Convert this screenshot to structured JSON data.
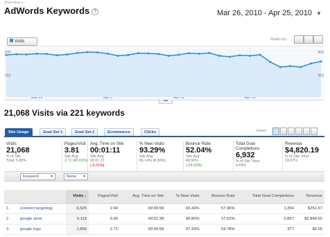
{
  "breadcrumb": "Overview »",
  "page_title": "AdWords Keywords",
  "help_glyph": "?",
  "date_range": "Mar 26, 2010 - Apr 25, 2010",
  "graph": {
    "metric_label": "Visits",
    "graph_by_label": "Graph by:",
    "y_label_top": "900",
    "y_label_mid": "450",
    "x_ticks": [
      "Mar 29",
      "Apr 5",
      "Apr 12",
      "Apr 19"
    ],
    "accent": "#2f8fdf"
  },
  "chart_data": {
    "type": "line",
    "series": [
      {
        "name": "Visits",
        "values": [
          815,
          830,
          825,
          840,
          835,
          810,
          825,
          855,
          870,
          865,
          840,
          800,
          815,
          850,
          845,
          835,
          800,
          820,
          850,
          840,
          855,
          800,
          780,
          810,
          800,
          820,
          680,
          580,
          600,
          580,
          650,
          690
        ]
      }
    ],
    "ylim": [
      0,
      900
    ],
    "y_ticks": [
      "450",
      "900"
    ],
    "x_tick_labels": [
      "Mar 29",
      "Apr 5",
      "Apr 12",
      "Apr 19"
    ],
    "grid": true
  },
  "summary": "21,068 Visits via 221 keywords",
  "tabs": [
    "Site Usage",
    "Goal Set 1",
    "Goal Set 2",
    "Ecommerce",
    "Clicks"
  ],
  "views_label": "Views:",
  "metrics": [
    {
      "label": "Visits",
      "value": "21,068",
      "sub1": "% of Site",
      "sub2": "Total: 5.88%",
      "sub3": ""
    },
    {
      "label": "Pages/Visit",
      "value": "3.81",
      "sub1": "Site Avg:",
      "sub2": "2.72",
      "sub3": "(40.01%)"
    },
    {
      "label": "Avg. Time on Site",
      "value": "00:01:11",
      "sub1": "Site Avg:",
      "sub2": "00:01:13",
      "sub3": "(-3.01%)"
    },
    {
      "label": "% New Visits",
      "value": "93.29%",
      "sub1": "Site Avg:",
      "sub2": "86.14%",
      "sub3": "(8.30%)"
    },
    {
      "label": "Bounce Rate",
      "value": "52.04%",
      "sub1": "Site Avg:",
      "sub2": "68.50%",
      "sub3": "(-24.02%)"
    },
    {
      "label": "Total Goal Completions",
      "value": "6,932",
      "sub1": "% of Site Total:",
      "sub2": "9.69%",
      "sub3": ""
    },
    {
      "label": "Revenue",
      "value": "$4,820.19",
      "sub1": "% of Site Total:",
      "sub2": "18.07%",
      "sub3": ""
    }
  ],
  "toolbar": {
    "dimension": "Keyword",
    "secondary": "None"
  },
  "table": {
    "headers": [
      "Visits ↓",
      "Pages/Visit",
      "Avg. Time on Site",
      "% New Visits",
      "Bounce Rate",
      "Total Goal Completions",
      "Revenue"
    ],
    "rows": [
      {
        "num": "1.",
        "keyword": "(content targeting)",
        "cells": [
          "6,525",
          "2.64",
          "00:00:58",
          "93.43%",
          "57.96%",
          "1,354",
          "$251.57"
        ]
      },
      {
        "num": "2.",
        "keyword": "google store",
        "cells": [
          "5,119",
          "5.60",
          "00:01:38",
          "90.80%",
          "27.62%",
          "2,857",
          "$2,846.02"
        ]
      },
      {
        "num": "3.",
        "keyword": "google logo",
        "cells": [
          "1,800",
          "2.71",
          "00:00:58",
          "97.33%",
          "64.78%",
          "377",
          "$0.00"
        ]
      }
    ]
  }
}
